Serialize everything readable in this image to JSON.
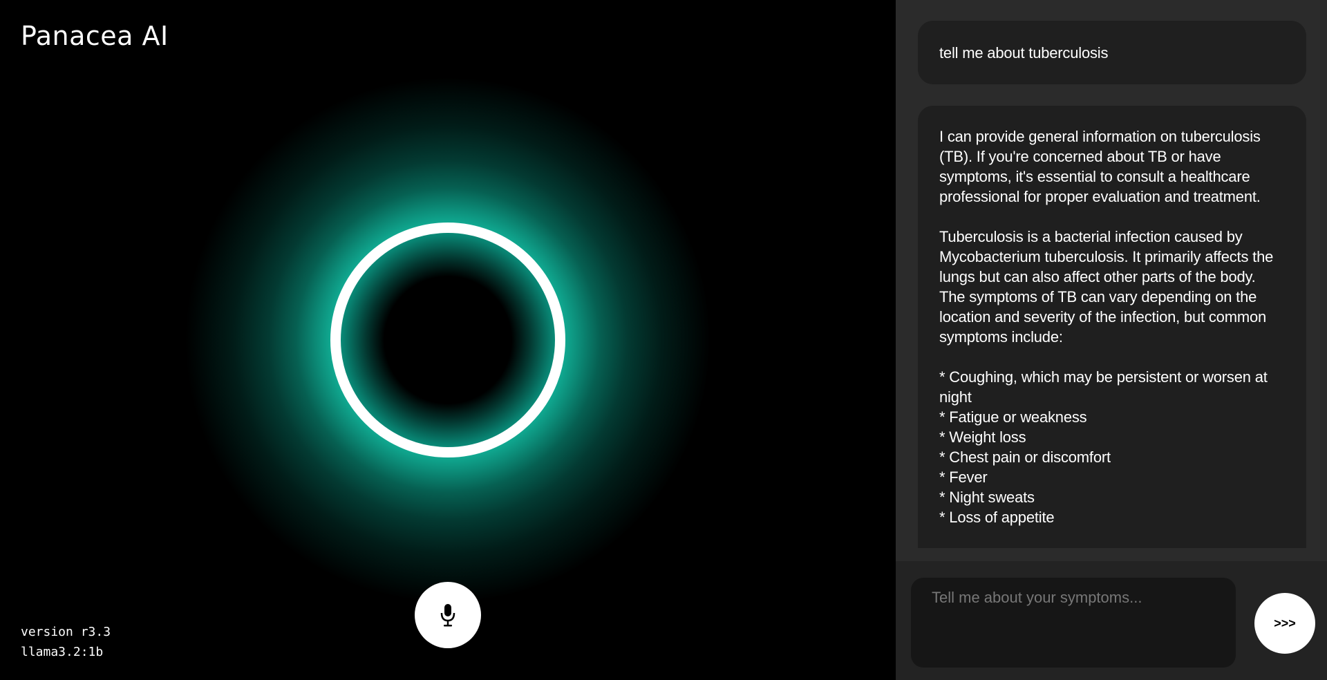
{
  "app": {
    "title": "Panacea AI"
  },
  "meta": {
    "version": "version r3.3",
    "model": "llama3.2:1b"
  },
  "colors": {
    "accent": "#10a890",
    "panel_bg": "#2b2b2b",
    "bubble_bg": "#1f1f1f"
  },
  "icons": {
    "mic": "microphone-icon"
  },
  "chat": {
    "user_message": "tell me about tuberculosis",
    "assistant_paragraphs": [
      "I can provide general information on tuberculosis (TB). If you're concerned about TB or have symptoms, it's essential to consult a healthcare professional for proper evaluation and treatment.",
      "Tuberculosis is a bacterial infection caused by Mycobacterium tuberculosis. It primarily affects the lungs but can also affect other parts of the body. The symptoms of TB can vary depending on the location and severity of the infection, but common symptoms include:"
    ],
    "assistant_list": [
      "Coughing, which may be persistent or worsen at night",
      "Fatigue or weakness",
      "Weight loss",
      "Chest pain or discomfort",
      "Fever",
      "Night sweats",
      "Loss of appetite"
    ]
  },
  "composer": {
    "placeholder": "Tell me about your symptoms...",
    "send_label": ">>>"
  }
}
